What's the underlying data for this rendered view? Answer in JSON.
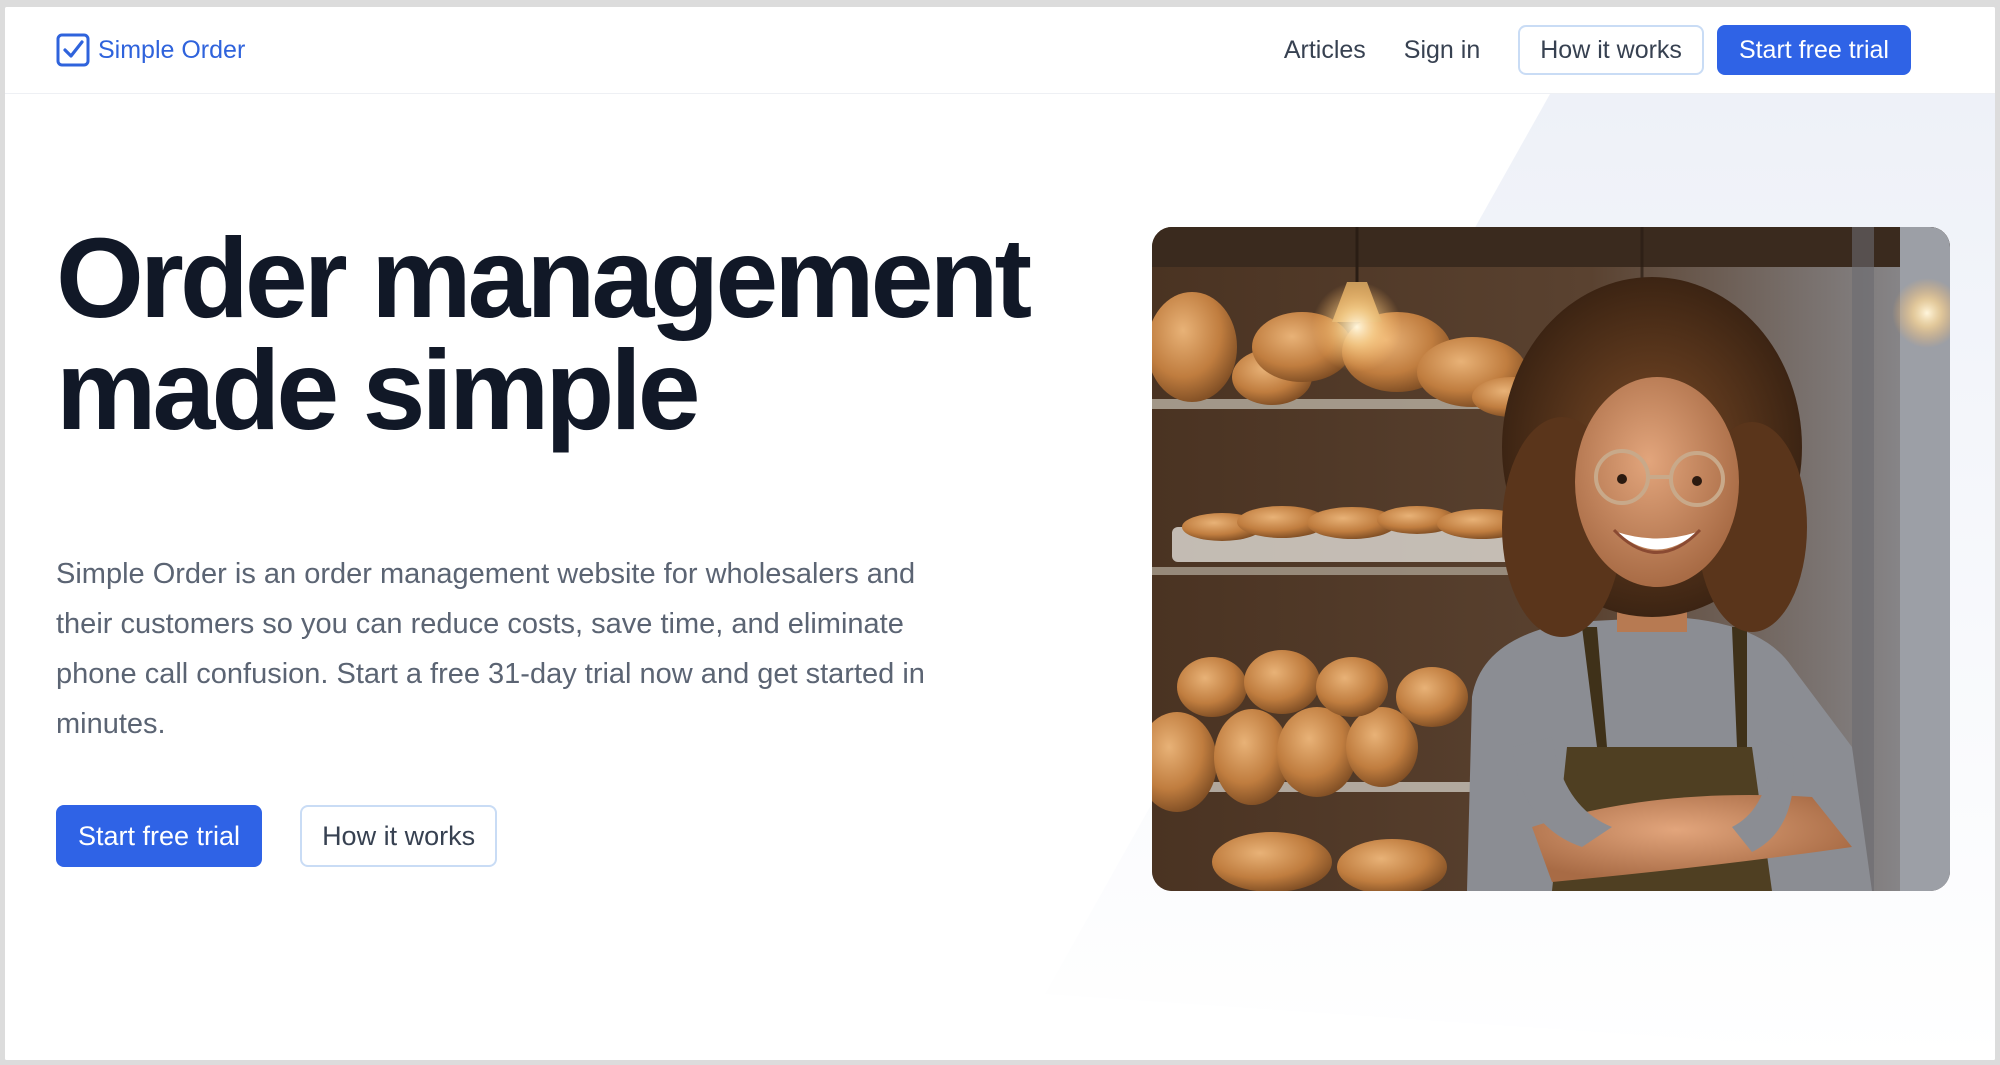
{
  "header": {
    "brand": "Simple Order",
    "nav": {
      "articles": "Articles",
      "sign_in": "Sign in",
      "how_it_works": "How it works",
      "start_trial": "Start free trial"
    }
  },
  "hero": {
    "title_line1": "Order management",
    "title_line2": "made simple",
    "description": "Simple Order is an order management website for wholesalers and their customers so you can reduce costs, save time, and eliminate phone call confusion. Start a free 31-day trial now and get started in minutes.",
    "primary_cta": "Start free trial",
    "secondary_cta": "How it works",
    "image_icon": "bakery-photo"
  },
  "colors": {
    "accent": "#2f63e6",
    "brand_text": "#2f63dc",
    "heading": "#111827",
    "body_text": "#5b6473",
    "outline_border": "#c9dcf5"
  }
}
